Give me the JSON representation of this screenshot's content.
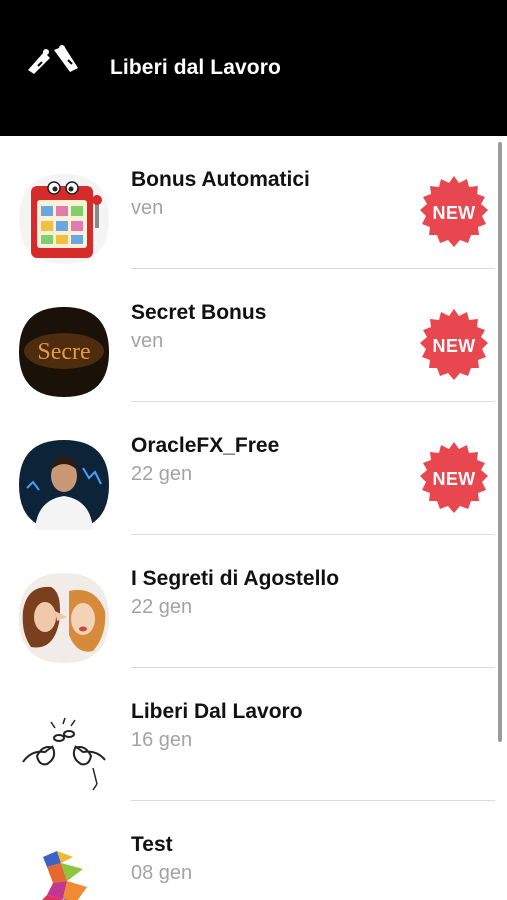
{
  "header": {
    "title": "Liberi dal Lavoro",
    "logo_icon": "broken-chain-icon"
  },
  "badge_text": "NEW",
  "colors": {
    "header_bg": "#000000",
    "badge": "#e8474f",
    "date_text": "#a3a3a3"
  },
  "chats": [
    {
      "title": "Bonus Automatici",
      "date": "ven",
      "is_new": true,
      "avatar_icon": "slot-machine-icon"
    },
    {
      "title": "Secret Bonus",
      "date": "ven",
      "is_new": true,
      "avatar_icon": "secret-text-icon"
    },
    {
      "title": "OracleFX_Free",
      "date": "22 gen",
      "is_new": true,
      "avatar_icon": "man-portrait-icon"
    },
    {
      "title": "I Segreti di Agostello",
      "date": "22 gen",
      "is_new": false,
      "avatar_icon": "whispering-women-icon"
    },
    {
      "title": "Liberi Dal Lavoro",
      "date": "16 gen",
      "is_new": false,
      "avatar_icon": "broken-chains-icon"
    },
    {
      "title": "Test",
      "date": "08 gen",
      "is_new": false,
      "avatar_icon": "polygon-runner-icon"
    }
  ]
}
